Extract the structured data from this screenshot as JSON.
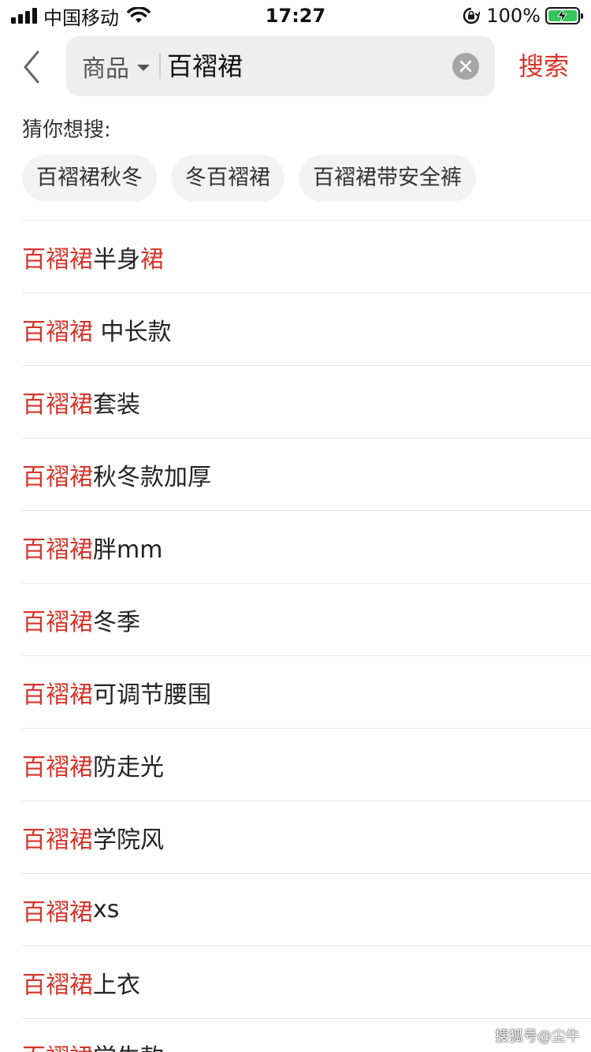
{
  "status_bar": {
    "carrier": "中国移动",
    "time": "17:27",
    "battery_percent": "100%",
    "battery_level": 1.0,
    "battery_color": "#34c759"
  },
  "header": {
    "back_icon": "chevron-left-icon",
    "scope_label": "商品",
    "query": "百褶裙",
    "clear_icon": "clear-icon",
    "search_button": "搜索",
    "accent_color": "#d6362c"
  },
  "guess": {
    "title": "猜你想搜:",
    "chips": [
      "百褶裙秋冬",
      "冬百褶裙",
      "百褶裙带安全裤"
    ]
  },
  "results": [
    {
      "hl": "百褶裙",
      "rest": "半身",
      "tail": "裙"
    },
    {
      "hl": "百褶裙",
      "rest": " 中长款",
      "tail": ""
    },
    {
      "hl": "百褶裙",
      "rest": "套装",
      "tail": ""
    },
    {
      "hl": "百褶裙",
      "rest": "秋冬款加厚",
      "tail": ""
    },
    {
      "hl": "百褶裙",
      "rest": "胖mm",
      "tail": ""
    },
    {
      "hl": "百褶裙",
      "rest": "冬季",
      "tail": ""
    },
    {
      "hl": "百褶裙",
      "rest": "可调节腰围",
      "tail": ""
    },
    {
      "hl": "百褶裙",
      "rest": "防走光",
      "tail": ""
    },
    {
      "hl": "百褶裙",
      "rest": "学院风",
      "tail": ""
    },
    {
      "hl": "百褶裙",
      "rest": "xs",
      "tail": ""
    },
    {
      "hl": "百褶裙",
      "rest": "上衣",
      "tail": ""
    },
    {
      "hl": "百褶裙",
      "rest": "学生款",
      "tail": ""
    }
  ],
  "watermark": "搜狐号@尘牛"
}
